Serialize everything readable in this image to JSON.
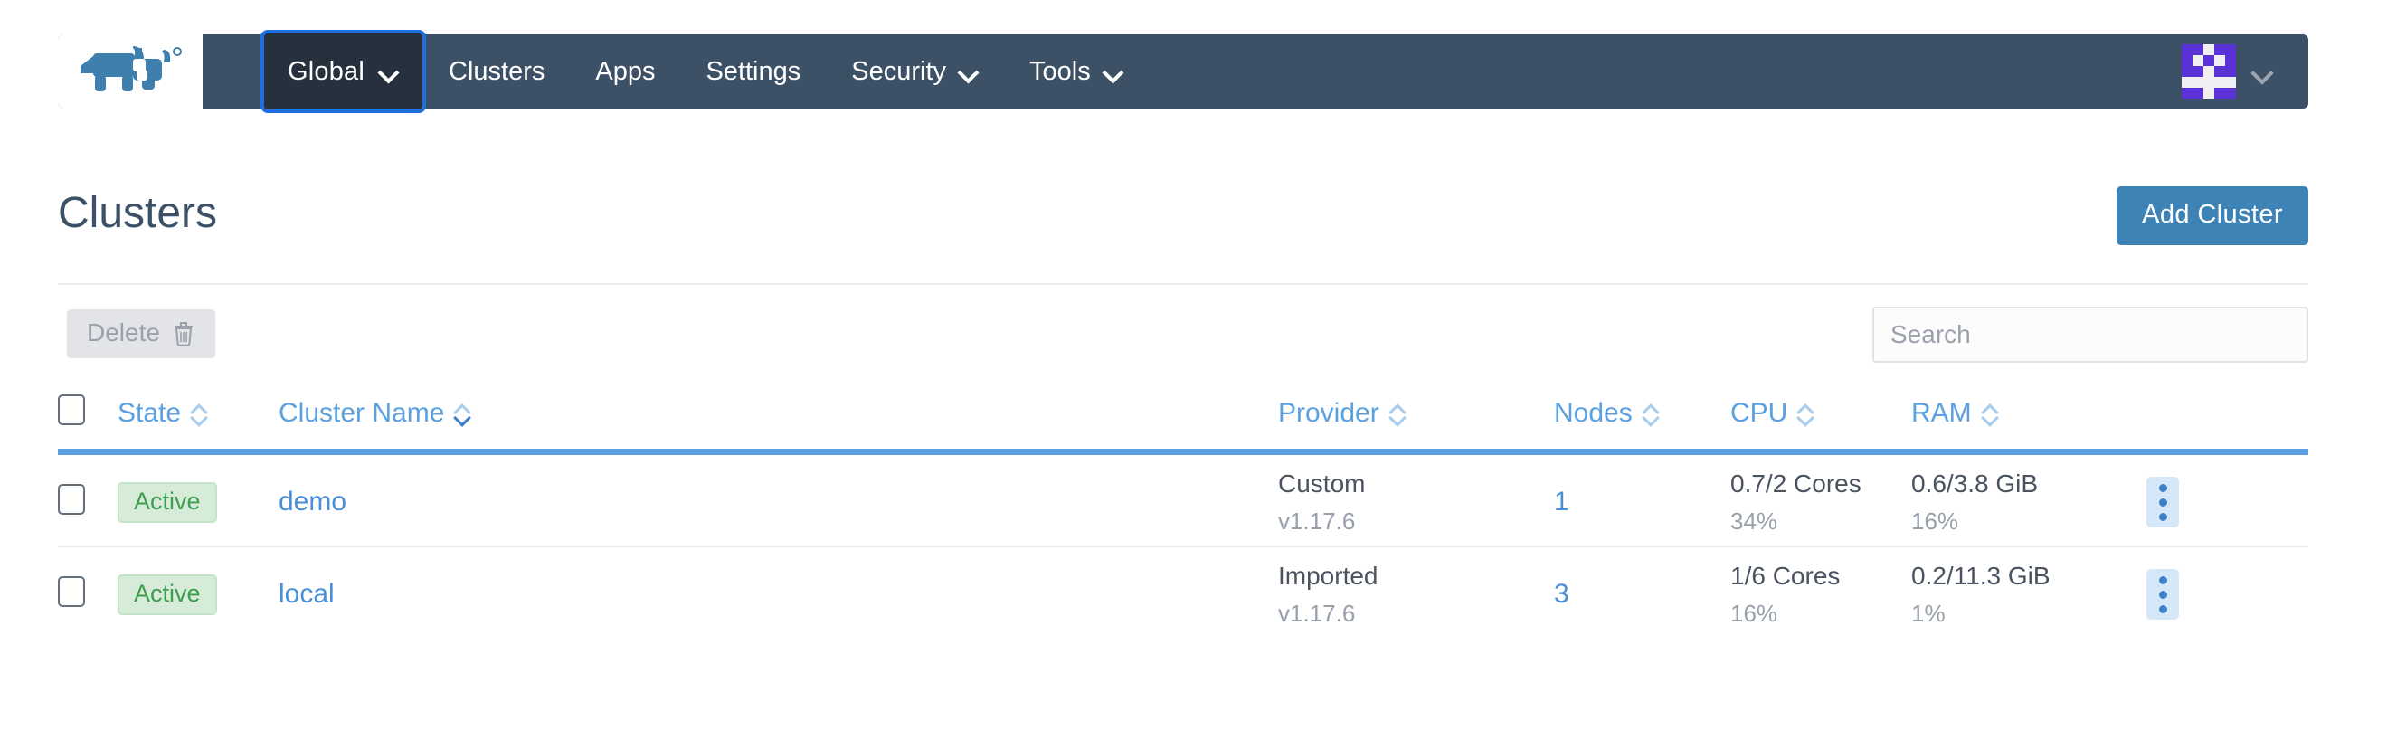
{
  "nav": {
    "logo_icon": "rancher-cow-logo",
    "context_selector": {
      "label": "Global",
      "icon": "chevron-down-icon"
    },
    "links": [
      {
        "label": "Clusters",
        "has_caret": false
      },
      {
        "label": "Apps",
        "has_caret": false
      },
      {
        "label": "Settings",
        "has_caret": false
      },
      {
        "label": "Security",
        "has_caret": true
      },
      {
        "label": "Tools",
        "has_caret": true
      }
    ],
    "user_menu": {
      "avatar_icon": "identicon-avatar",
      "caret_icon": "chevron-down-icon"
    }
  },
  "page": {
    "title": "Clusters",
    "add_button": "Add Cluster"
  },
  "toolbar": {
    "delete_label": "Delete",
    "delete_icon": "trash-icon",
    "search_placeholder": "Search",
    "search_value": ""
  },
  "table": {
    "columns": [
      {
        "key": "state",
        "label": "State",
        "sorted": false
      },
      {
        "key": "name",
        "label": "Cluster Name",
        "sorted": true
      },
      {
        "key": "provider",
        "label": "Provider",
        "sorted": false
      },
      {
        "key": "nodes",
        "label": "Nodes",
        "sorted": false
      },
      {
        "key": "cpu",
        "label": "CPU",
        "sorted": false
      },
      {
        "key": "ram",
        "label": "RAM",
        "sorted": false
      }
    ],
    "rows": [
      {
        "state": "Active",
        "name": "demo",
        "provider": "Custom",
        "version": "v1.17.6",
        "nodes": "1",
        "cpu": "0.7/2 Cores",
        "cpu_pct": "34%",
        "ram": "0.6/3.8 GiB",
        "ram_pct": "16%",
        "actions_icon": "kebab-menu-icon"
      },
      {
        "state": "Active",
        "name": "local",
        "provider": "Imported",
        "version": "v1.17.6",
        "nodes": "3",
        "cpu": "1/6 Cores",
        "cpu_pct": "16%",
        "ram": "0.2/11.3 GiB",
        "ram_pct": "1%",
        "actions_icon": "kebab-menu-icon"
      }
    ]
  },
  "colors": {
    "nav_bg": "#3d5166",
    "nav_active_bg": "#27313d",
    "nav_active_border": "#1f6fe0",
    "primary_button": "#3e83b6",
    "link": "#4a90d9",
    "header_text": "#5ba0e0",
    "rule": "#5ba0e0",
    "badge_bg": "#d6ecd9",
    "badge_text": "#3f9c51",
    "avatar": "#5b32d6"
  }
}
